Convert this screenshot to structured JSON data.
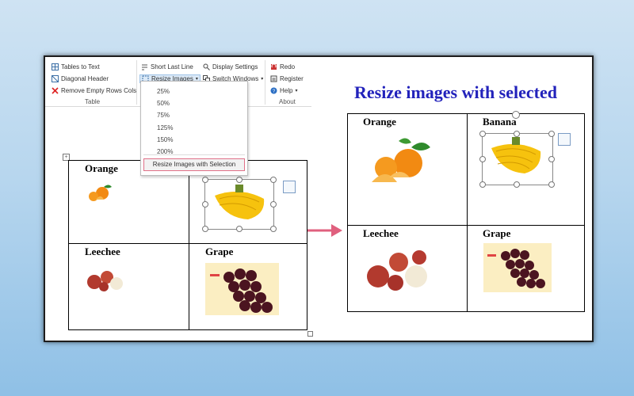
{
  "ribbon": {
    "table_group": {
      "label": "Table",
      "items": [
        {
          "label": "Tables to Text",
          "icon": "table-text-icon"
        },
        {
          "label": "Diagonal Header",
          "icon": "diagonal-header-icon"
        },
        {
          "label": "Remove Empty Rows Cols",
          "icon": "remove-rows-icon"
        }
      ]
    },
    "image_group": {
      "short_last_line": "Short Last Line",
      "resize_images": "Resize Images",
      "display_settings": "Display Settings",
      "switch_windows": "Switch Windows"
    },
    "about_group": {
      "label": "About",
      "redo": "Redo",
      "register": "Register",
      "help": "Help"
    }
  },
  "dropdown": {
    "options": [
      "25%",
      "50%",
      "75%",
      "125%",
      "150%",
      "200%"
    ],
    "selected": "Resize Images with Selection"
  },
  "left_table": {
    "cells": [
      "Orange",
      "",
      "Leechee",
      "Grape"
    ]
  },
  "right_panel": {
    "title": "Resize images with selected",
    "cells": [
      "Orange",
      "Banana",
      "Leechee",
      "Grape"
    ]
  },
  "colors": {
    "title": "#2222bb",
    "arrow": "#e0607e",
    "selection_border": "#e07088"
  }
}
